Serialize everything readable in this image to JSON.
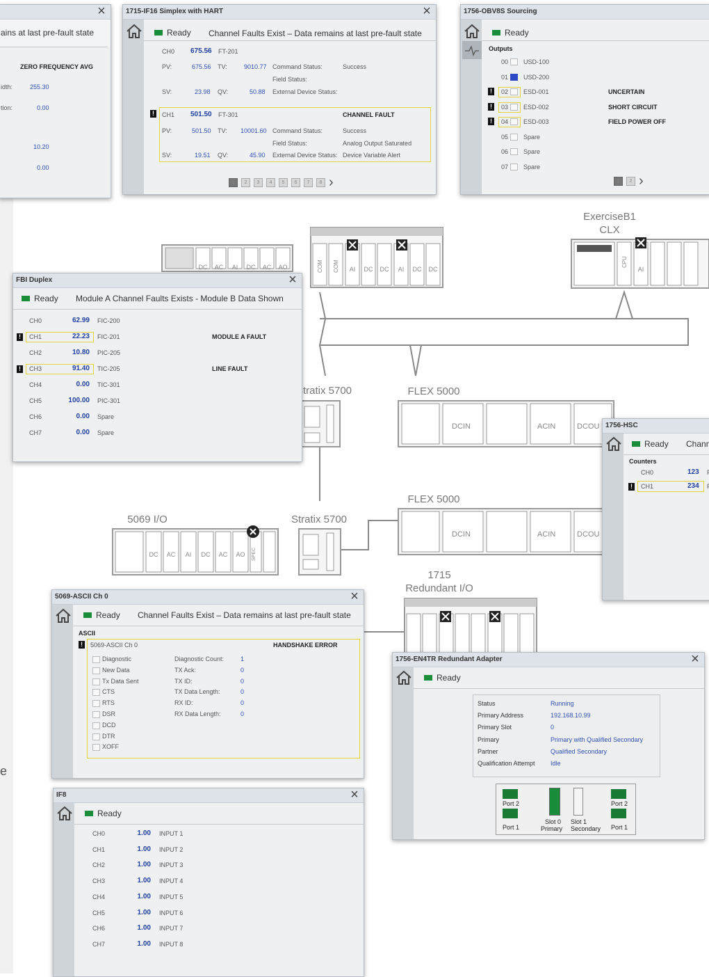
{
  "network": {
    "exercise_b1": "ExerciseB1",
    "clx": "CLX",
    "stratix_top": "Stratix 5700",
    "stratix_bottom": "Stratix 5700",
    "flex_top": "FLEX 5000",
    "flex_bottom": "FLEX 5000",
    "io_5069": "5069 I/O",
    "redundant_1715_a": "1715",
    "redundant_1715_b": "Redundant I/O",
    "mod_labels": {
      "dc": "DC",
      "ac": "AC",
      "ai": "AI",
      "ao": "AO",
      "com": "COM",
      "cpu": "CPU",
      "spec": "SPEC",
      "dcin": "DCIN",
      "acin": "ACIN",
      "dcou": "DCOU"
    }
  },
  "left_partial": {
    "msg": "ains at last pre-fault state",
    "title": "ZERO FREQUENCY AVG",
    "rows": [
      {
        "label": "idth:",
        "value": "255.30"
      },
      {
        "label": "tion:",
        "value": "0.00"
      },
      {
        "label": "",
        "value": "10.20"
      },
      {
        "label": "",
        "value": "0.00"
      }
    ],
    "edge_letter": "e"
  },
  "hart": {
    "title": "1715-IF16 Simplex with HART",
    "ready": "Ready",
    "message": "Channel Faults Exist – Data remains at last pre-fault state",
    "ch0": {
      "ch": "CH0",
      "value": "675.56",
      "tag": "FT-201",
      "pv_label": "PV:",
      "pv": "675.56",
      "tv_label": "TV:",
      "tv": "9010.77",
      "sv_label": "SV:",
      "sv": "23.98",
      "qv_label": "QV:",
      "qv": "50.88",
      "cmd_label": "Command Status:",
      "cmd": "Success",
      "field_label": "Field Status:",
      "field": "",
      "ext_label": "External Device Status:",
      "ext": ""
    },
    "ch1": {
      "ch": "CH1",
      "value": "501.50",
      "tag": "FT-301",
      "fault": "CHANNEL FAULT",
      "pv_label": "PV:",
      "pv": "501.50",
      "tv_label": "TV:",
      "tv": "10001.60",
      "sv_label": "SV:",
      "sv": "19.51",
      "qv_label": "QV:",
      "qv": "45.90",
      "cmd_label": "Command Status:",
      "cmd": "Success",
      "field_label": "Field Status:",
      "field": "Analog Output Saturated",
      "ext_label": "External Device Status:",
      "ext": "Device Variable Alert"
    },
    "pages": [
      "1",
      "2",
      "3",
      "4",
      "5",
      "6",
      "7",
      "8"
    ],
    "next": "›"
  },
  "obv8s": {
    "title": "1756-OBV8S Sourcing",
    "ready": "Ready",
    "section": "Outputs",
    "rows": [
      {
        "ch": "00",
        "tag": "USD-100",
        "on": false,
        "fault": "",
        "status": ""
      },
      {
        "ch": "01",
        "tag": "USD-200",
        "on": true,
        "fault": "",
        "status": ""
      },
      {
        "ch": "02",
        "tag": "ESD-001",
        "on": false,
        "fault": "!",
        "status": "UNCERTAIN"
      },
      {
        "ch": "03",
        "tag": "ESD-002",
        "on": false,
        "fault": "!",
        "status": "SHORT CIRCUIT"
      },
      {
        "ch": "04",
        "tag": "ESD-003",
        "on": false,
        "fault": "!",
        "status": "FIELD POWER OFF"
      },
      {
        "ch": "05",
        "tag": "Spare",
        "on": false,
        "fault": "",
        "status": ""
      },
      {
        "ch": "06",
        "tag": "Spare",
        "on": false,
        "fault": "",
        "status": ""
      },
      {
        "ch": "07",
        "tag": "Spare",
        "on": false,
        "fault": "",
        "status": ""
      }
    ],
    "pages": [
      "1",
      "2"
    ],
    "next": "›"
  },
  "fbi": {
    "title": "FBI Duplex",
    "ready": "Ready",
    "message": "Module A Channel Faults Exists - Module B Data Shown",
    "rows": [
      {
        "ch": "CH0",
        "value": "62.99",
        "tag": "FIC-200",
        "fault": "",
        "status": ""
      },
      {
        "ch": "CH1",
        "value": "22.23",
        "tag": "FIC-201",
        "fault": "!",
        "status": "MODULE A FAULT"
      },
      {
        "ch": "CH2",
        "value": "10.80",
        "tag": "PIC-205",
        "fault": "",
        "status": ""
      },
      {
        "ch": "CH3",
        "value": "91.40",
        "tag": "TIC-205",
        "fault": "!",
        "status": "LINE FAULT"
      },
      {
        "ch": "CH4",
        "value": "0.00",
        "tag": "TIC-301",
        "fault": "",
        "status": ""
      },
      {
        "ch": "CH5",
        "value": "100.00",
        "tag": "PIC-301",
        "fault": "",
        "status": ""
      },
      {
        "ch": "CH6",
        "value": "0.00",
        "tag": "Spare",
        "fault": "",
        "status": ""
      },
      {
        "ch": "CH7",
        "value": "0.00",
        "tag": "Spare",
        "fault": "",
        "status": ""
      }
    ]
  },
  "hsc": {
    "title": "1756-HSC",
    "ready": "Ready",
    "message": "Chann",
    "section": "Counters",
    "rows": [
      {
        "ch": "CH0",
        "value": "123",
        "extra": "F",
        "fault": ""
      },
      {
        "ch": "CH1",
        "value": "234",
        "extra": "F",
        "fault": "!"
      }
    ]
  },
  "ascii": {
    "title": "5069-ASCII Ch 0",
    "ready": "Ready",
    "message": "Channel Faults Exist – Data remains at last pre-fault state",
    "section": "ASCII",
    "channel": "5069-ASCII Ch 0",
    "fault": "HANDSHAKE ERROR",
    "flags": [
      "Diagnostic",
      "New Data",
      "Tx Data Sent",
      "CTS",
      "RTS",
      "DSR",
      "DCD",
      "DTR",
      "XOFF"
    ],
    "stats": [
      {
        "label": "Diagnostic Count:",
        "value": "1"
      },
      {
        "label": "TX Ack:",
        "value": "0"
      },
      {
        "label": "TX ID:",
        "value": "0"
      },
      {
        "label": "TX Data Length:",
        "value": "0"
      },
      {
        "label": "RX ID:",
        "value": "0"
      },
      {
        "label": "RX Data Length:",
        "value": "0"
      }
    ]
  },
  "en4tr": {
    "title": "1756-EN4TR Redundant Adapter",
    "ready": "Ready",
    "rows": [
      {
        "label": "Status",
        "value": "Running"
      },
      {
        "label": "Primary Address",
        "value": "192.168.10.99"
      },
      {
        "label": "Primary Slot",
        "value": "0"
      },
      {
        "label": "Primary",
        "value": "Primary with Qualified Secondary"
      },
      {
        "label": "Partner",
        "value": "Qualified Secondary"
      },
      {
        "label": "Qualification Attempt",
        "value": "Idle"
      }
    ],
    "port2_left": "Port 2",
    "port1_left": "Port 1",
    "slot0_a": "Slot 0",
    "slot0_b": "Primary",
    "slot1_a": "Slot 1",
    "slot1_b": "Secondary",
    "port2_right": "Port 2",
    "port1_right": "Port 1",
    "com": "COM"
  },
  "if8": {
    "title": "IF8",
    "ready": "Ready",
    "rows": [
      {
        "ch": "CH0",
        "value": "1.00",
        "tag": "INPUT 1"
      },
      {
        "ch": "CH1",
        "value": "1.00",
        "tag": "INPUT 2"
      },
      {
        "ch": "CH2",
        "value": "1.00",
        "tag": "INPUT 3"
      },
      {
        "ch": "CH3",
        "value": "1.00",
        "tag": "INPUT 4"
      },
      {
        "ch": "CH4",
        "value": "1.00",
        "tag": "INPUT 5"
      },
      {
        "ch": "CH5",
        "value": "1.00",
        "tag": "INPUT 6"
      },
      {
        "ch": "CH6",
        "value": "1.00",
        "tag": "INPUT 7"
      },
      {
        "ch": "CH7",
        "value": "1.00",
        "tag": "INPUT 8"
      }
    ]
  }
}
